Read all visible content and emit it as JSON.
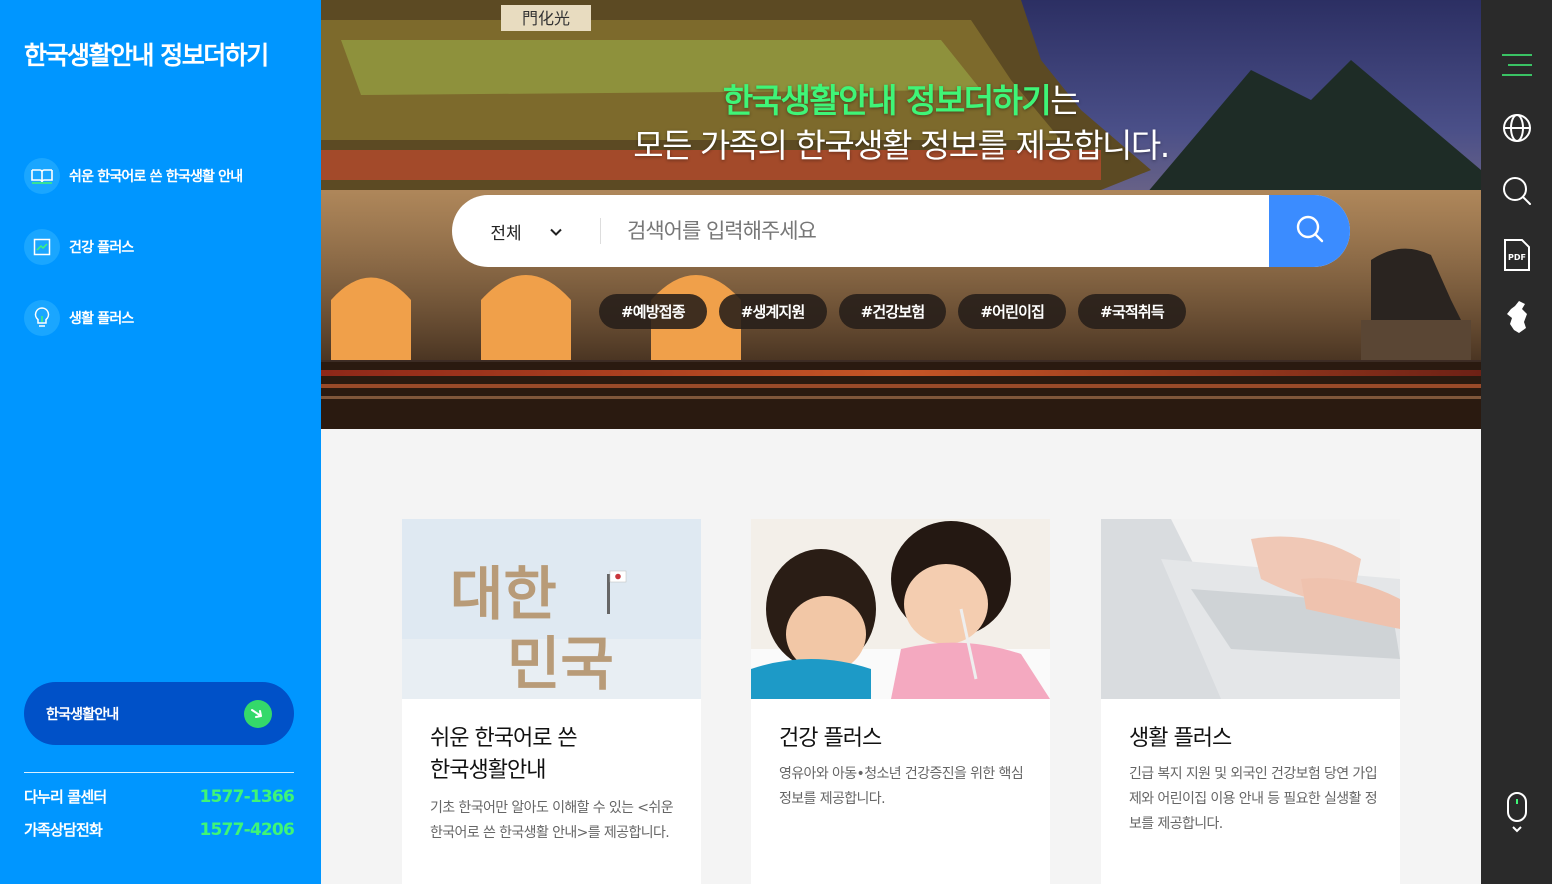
{
  "sidebar": {
    "title": "한국생활안내 정보더하기",
    "nav": [
      {
        "label": "쉬운 한국어로 쓴 한국생활 안내",
        "icon": "book-icon"
      },
      {
        "label": "건강 플러스",
        "icon": "chart-icon"
      },
      {
        "label": "생활 플러스",
        "icon": "lightbulb-icon"
      }
    ],
    "guide_button": "한국생활안내",
    "contacts": [
      {
        "label": "다누리 콜센터",
        "number": "1577-1366"
      },
      {
        "label": "가족상담전화",
        "number": "1577-4206"
      }
    ]
  },
  "hero": {
    "title_highlight": "한국생활안내 정보더하기",
    "title_suffix": "는",
    "subtitle": "모든 가족의 한국생활 정보를 제공합니다.",
    "search": {
      "category": "전체",
      "placeholder": "검색어를 입력해주세요"
    },
    "tags": [
      "#예방접종",
      "#생계지원",
      "#건강보험",
      "#어린이집",
      "#국적취득"
    ],
    "gate_sign": "門化光"
  },
  "cards": [
    {
      "title_line1": "쉬운 한국어로 쓴",
      "title_line2": "한국생활안내",
      "desc": "기초 한국어만 알아도 이해할 수 있는 <쉬운 한국어로 쓴 한국생활 안내>를 제공합니다.",
      "image_text": [
        "대한",
        "민국"
      ]
    },
    {
      "title_line1": "건강 플러스",
      "title_line2": "",
      "desc": "영유아와 아동•청소년 건강증진을 위한 핵심 정보를 제공합니다."
    },
    {
      "title_line1": "생활 플러스",
      "title_line2": "",
      "desc": "긴급 복지 지원 및 외국인 건강보험 당연 가입제와 어린이집 이용 안내 등 필요한 실생활 정보를 제공합니다."
    }
  ],
  "rail": {
    "icons": [
      "menu-icon",
      "globe-icon",
      "search-icon",
      "pdf-icon",
      "korea-map-icon",
      "mouse-scroll-icon"
    ],
    "pdf_label": "PDF"
  },
  "colors": {
    "sidebar_bg": "#0096ff",
    "accent_green": "#3ff577",
    "guide_button_bg": "#0051c8",
    "search_button_bg": "#3b8cff",
    "rail_bg": "#2a2a2a"
  }
}
